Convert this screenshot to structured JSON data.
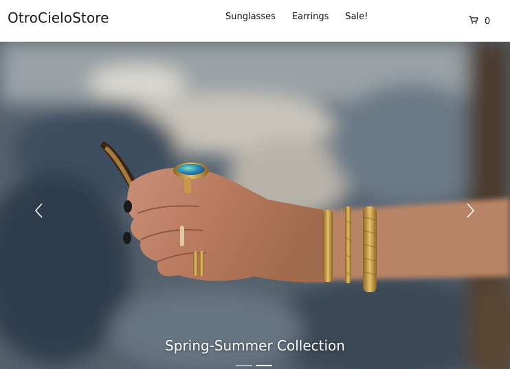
{
  "store": {
    "name": "OtroCieloStore"
  },
  "nav": {
    "items": [
      {
        "label": "Sunglasses"
      },
      {
        "label": "Earrings"
      },
      {
        "label": "Sale!"
      }
    ]
  },
  "cart": {
    "icon": "cart-icon",
    "count": "0"
  },
  "slider": {
    "caption": "Spring-Summer Collection",
    "prev_icon": "chevron-left-icon",
    "next_icon": "chevron-right-icon",
    "slide_count": 2,
    "active_slide": 2
  },
  "colors": {
    "header_bg": "#ffffff",
    "text": "#111111",
    "caption": "#ffffff"
  }
}
